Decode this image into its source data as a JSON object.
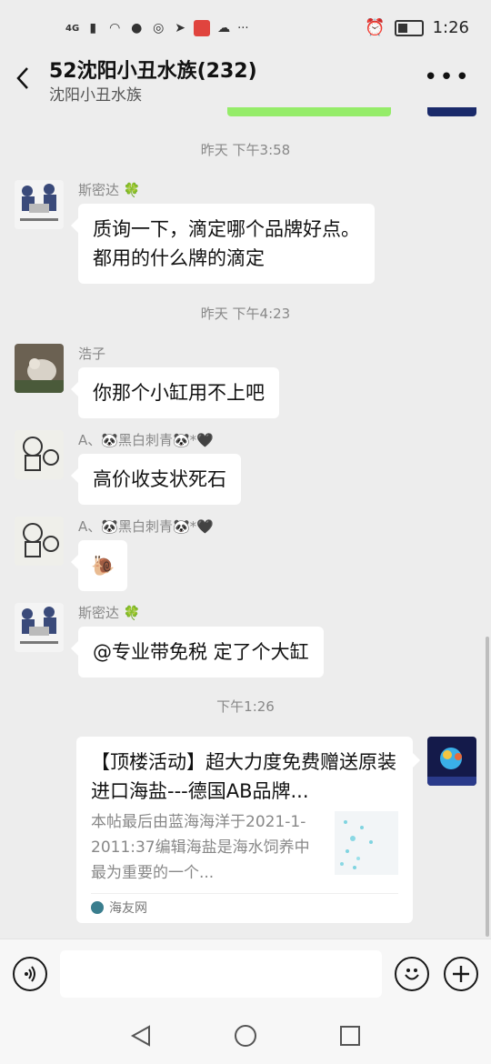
{
  "status_bar": {
    "network": "4G",
    "time": "1:26",
    "more": "···"
  },
  "header": {
    "title": "52沈阳小丑水族(232)",
    "subtitle": "沈阳小丑水族",
    "back_label": "<",
    "more_label": "•••"
  },
  "messages": [
    {
      "type": "time",
      "text": "昨天 下午3:58"
    },
    {
      "type": "text",
      "sender": "斯密达 🍀",
      "lines": [
        "质询一下，滴定哪个品牌好点。",
        "都用的什么牌的滴定"
      ]
    },
    {
      "type": "time",
      "text": "昨天 下午4:23"
    },
    {
      "type": "text",
      "sender": "浩子",
      "lines": [
        "你那个小缸用不上吧"
      ]
    },
    {
      "type": "text",
      "sender": "A、🐼黑白刺青🐼*🖤",
      "lines": [
        "高价收支状死石"
      ]
    },
    {
      "type": "emoji",
      "sender": "A、🐼黑白刺青🐼*🖤",
      "emoji": "🐌"
    },
    {
      "type": "text",
      "sender": "斯密达 🍀",
      "lines": [
        "@专业带免税  定了个大缸"
      ]
    },
    {
      "type": "time",
      "text": "下午1:26"
    }
  ],
  "link_card": {
    "title": "【顶楼活动】超大力度免费赠送原装进口海盐---德国AB品牌...",
    "description": "本帖最后由蓝海海洋于2021-1-2011:37编辑海盐是海水饲养中最为重要的一个...",
    "source": "海友网"
  },
  "input_bar": {
    "voice_icon": "voice-icon",
    "emoji_icon": "emoji-icon",
    "plus_icon": "plus-icon",
    "placeholder": ""
  },
  "colors": {
    "background": "#ededed",
    "bubble": "#ffffff",
    "sent_bubble": "#95ec69",
    "time_text": "#888888"
  }
}
